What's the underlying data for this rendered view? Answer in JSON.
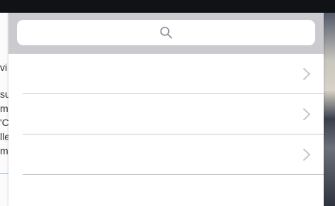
{
  "background_app": {
    "fragments": [
      "vi",
      "su",
      "my",
      "'C",
      "lle",
      "m"
    ]
  },
  "search": {
    "placeholder": "",
    "value": ""
  },
  "list": {
    "rows": [
      {
        "label": ""
      },
      {
        "label": ""
      },
      {
        "label": ""
      }
    ]
  },
  "icons": {
    "search": "search-icon",
    "chevron": "chevron-right-icon"
  },
  "colors": {
    "search_region": "#cacacf",
    "separator": "#c8c7cc",
    "chevron": "#c7c7cc",
    "search_icon": "#8e8e93"
  }
}
